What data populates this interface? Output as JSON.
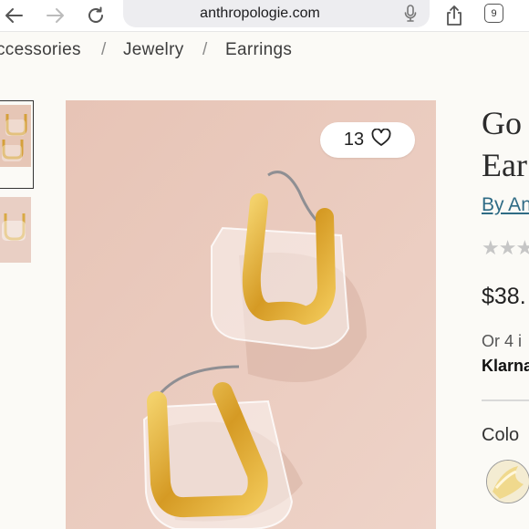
{
  "browser": {
    "url": "anthropologie.com",
    "tab_count": "9",
    "icons": [
      "back-arrow-icon",
      "forward-arrow-icon",
      "reload-icon",
      "microphone-icon",
      "share-icon",
      "tabs-icon"
    ]
  },
  "breadcrumb": {
    "items": [
      "ccessories",
      "Jewelry",
      "Earrings"
    ],
    "separator": "/"
  },
  "gallery": {
    "favorite_count": "13",
    "colors": {
      "background": "#e8c9bb",
      "gold": "#d9a532"
    }
  },
  "product": {
    "title_line1": "Go",
    "title_line2": "Ear",
    "brand_link": "By An",
    "rating_stars": "★★★",
    "price": "$38.",
    "installments": "Or 4 i",
    "klarna": "Klarna",
    "color_label": "Colo"
  },
  "theme": {
    "link": "#2e6b85",
    "page_bg": "#fbfaf6"
  }
}
